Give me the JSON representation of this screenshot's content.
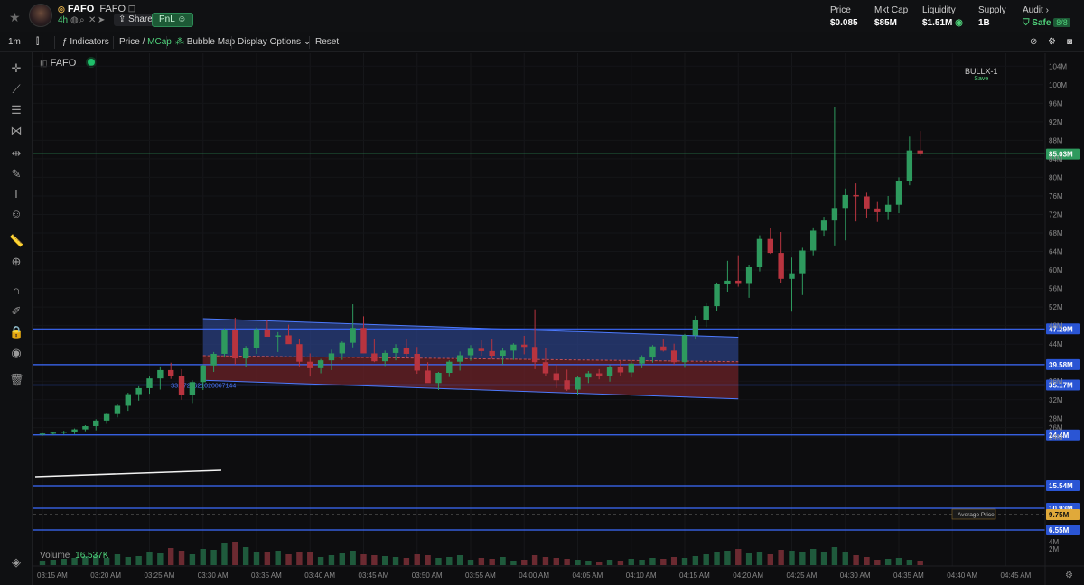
{
  "header": {
    "token_symbol": "FAFO",
    "token_name": "FAFO",
    "age": "4h",
    "share_label": "Share",
    "pnl_label": "PnL",
    "stats": [
      {
        "label": "Price",
        "value": "$0.085"
      },
      {
        "label": "Mkt Cap",
        "value": "$85M"
      },
      {
        "label": "Liquidity",
        "value": "$1.51M"
      },
      {
        "label": "Supply",
        "value": "1B"
      },
      {
        "label": "Audit",
        "value": "Safe",
        "extra": "8/8"
      }
    ]
  },
  "toolbar": {
    "interval": "1m",
    "indicators": "Indicators",
    "price": "Price",
    "slash": "/",
    "mcap": "MCap",
    "bubble_map": "Bubble Map",
    "display_options": "Display Options",
    "reset": "Reset",
    "layout_name": "BULLX-1",
    "layout_save": "Save"
  },
  "left_tools": [
    "crosshair-icon",
    "trendline-icon",
    "fib-icon",
    "pattern-icon",
    "forecast-icon",
    "brush-icon",
    "text-icon",
    "emoji-icon",
    "ruler-icon",
    "zoom-icon",
    "magnet-icon",
    "lock-draw-icon",
    "lock-icon",
    "eye-icon",
    "trash-icon",
    "layers-icon"
  ],
  "legend": {
    "symbol": "FAFO",
    "volume_label": "Volume",
    "volume_value": "16.537K"
  },
  "chart_data": {
    "type": "candlestick",
    "y_unit": "market cap (USD)",
    "ylim": [
      0,
      106
    ],
    "y_ticks": [
      "2M",
      "4M",
      "24M",
      "26M",
      "28M",
      "32M",
      "36M",
      "44M",
      "48M",
      "52M",
      "56M",
      "60M",
      "64M",
      "68M",
      "72M",
      "76M",
      "80M",
      "84M",
      "88M",
      "92M",
      "96M",
      "100M",
      "104M"
    ],
    "x_ticks": [
      "03:15 AM",
      "03:20 AM",
      "03:25 AM",
      "03:30 AM",
      "03:35 AM",
      "03:40 AM",
      "03:45 AM",
      "03:50 AM",
      "03:55 AM",
      "04:00 AM",
      "04:05 AM",
      "04:10 AM",
      "04:15 AM",
      "04:20 AM",
      "04:25 AM",
      "04:30 AM",
      "04:35 AM",
      "04:40 AM",
      "04:45 AM"
    ],
    "candles": [
      [
        24.5,
        24.8,
        24.2,
        24.7
      ],
      [
        24.7,
        25.0,
        24.4,
        24.9
      ],
      [
        24.9,
        25.3,
        24.5,
        25.1
      ],
      [
        25.1,
        25.8,
        24.6,
        25.6
      ],
      [
        25.6,
        26.5,
        25.2,
        26.3
      ],
      [
        26.3,
        27.8,
        25.4,
        27.5
      ],
      [
        27.5,
        29.2,
        26.8,
        28.9
      ],
      [
        28.9,
        31.0,
        28.2,
        30.7
      ],
      [
        30.7,
        33.5,
        29.6,
        33.2
      ],
      [
        33.2,
        34.9,
        31.8,
        34.5
      ],
      [
        34.5,
        37.0,
        33.3,
        36.6
      ],
      [
        36.6,
        39.2,
        34.2,
        38.4
      ],
      [
        38.4,
        40.0,
        36.5,
        37.2
      ],
      [
        37.2,
        38.6,
        32.0,
        33.1
      ],
      [
        33.1,
        36.2,
        31.3,
        35.8
      ],
      [
        35.8,
        39.6,
        34.1,
        39.4
      ],
      [
        39.4,
        42.3,
        38.0,
        41.9
      ],
      [
        41.9,
        47.4,
        41.1,
        47.0
      ],
      [
        47.0,
        49.7,
        39.6,
        40.9
      ],
      [
        40.9,
        43.6,
        39.1,
        43.1
      ],
      [
        43.1,
        47.6,
        41.9,
        47.2
      ],
      [
        47.2,
        49.3,
        45.8,
        45.6
      ],
      [
        45.6,
        46.6,
        42.3,
        45.9
      ],
      [
        45.9,
        48.2,
        44.1,
        44.0
      ],
      [
        44.0,
        45.2,
        39.2,
        40.2
      ],
      [
        40.2,
        42.0,
        37.0,
        38.8
      ],
      [
        38.8,
        40.8,
        37.7,
        40.5
      ],
      [
        40.5,
        42.8,
        38.4,
        42.0
      ],
      [
        42.0,
        44.6,
        40.6,
        44.3
      ],
      [
        44.3,
        52.6,
        43.3,
        47.5
      ],
      [
        47.5,
        50.0,
        42.6,
        42.0
      ],
      [
        42.0,
        45.0,
        40.1,
        40.3
      ],
      [
        40.3,
        42.6,
        39.3,
        42.1
      ],
      [
        42.1,
        44.0,
        40.5,
        43.2
      ],
      [
        43.2,
        45.1,
        41.3,
        41.9
      ],
      [
        41.9,
        43.4,
        37.6,
        38.3
      ],
      [
        38.3,
        40.1,
        35.7,
        35.6
      ],
      [
        35.6,
        38.0,
        34.1,
        37.8
      ],
      [
        37.8,
        40.5,
        36.9,
        40.2
      ],
      [
        40.2,
        42.4,
        38.3,
        41.6
      ],
      [
        41.6,
        43.8,
        40.4,
        43.0
      ],
      [
        43.0,
        44.8,
        41.5,
        42.5
      ],
      [
        42.5,
        45.0,
        40.9,
        41.5
      ],
      [
        41.5,
        43.1,
        39.6,
        42.6
      ],
      [
        42.6,
        44.2,
        40.6,
        43.9
      ],
      [
        43.9,
        45.8,
        41.8,
        43.4
      ],
      [
        43.4,
        51.5,
        38.6,
        40.1
      ],
      [
        40.1,
        43.1,
        37.2,
        37.7
      ],
      [
        37.7,
        39.7,
        34.5,
        36.2
      ],
      [
        36.2,
        38.5,
        33.9,
        34.2
      ],
      [
        34.2,
        37.2,
        33.1,
        36.8
      ],
      [
        36.8,
        38.2,
        35.6,
        37.7
      ],
      [
        37.7,
        38.6,
        36.4,
        37.1
      ],
      [
        37.1,
        39.5,
        35.9,
        39.1
      ],
      [
        39.1,
        40.5,
        37.2,
        37.9
      ],
      [
        37.9,
        40.4,
        36.8,
        39.8
      ],
      [
        39.8,
        41.6,
        38.8,
        41.1
      ],
      [
        41.1,
        43.8,
        40.0,
        43.5
      ],
      [
        43.5,
        45.2,
        42.4,
        42.6
      ],
      [
        42.6,
        44.1,
        39.6,
        40.1
      ],
      [
        40.1,
        46.2,
        38.9,
        45.9
      ],
      [
        45.9,
        50.1,
        45.0,
        49.3
      ],
      [
        49.3,
        52.8,
        47.7,
        52.2
      ],
      [
        52.2,
        57.3,
        51.1,
        56.9
      ],
      [
        56.9,
        62.0,
        55.2,
        57.7
      ],
      [
        57.7,
        63.0,
        56.4,
        57.0
      ],
      [
        57.0,
        61.0,
        54.0,
        60.6
      ],
      [
        60.6,
        67.5,
        59.7,
        66.7
      ],
      [
        66.7,
        69.0,
        63.5,
        63.7
      ],
      [
        63.7,
        68.2,
        57.1,
        58.1
      ],
      [
        58.1,
        62.7,
        51.0,
        59.3
      ],
      [
        59.3,
        64.8,
        54.6,
        64.2
      ],
      [
        64.2,
        69.2,
        63.0,
        68.5
      ],
      [
        68.5,
        71.5,
        67.4,
        70.7
      ],
      [
        70.7,
        95.2,
        65.3,
        73.4
      ],
      [
        73.4,
        77.6,
        66.4,
        76.2
      ],
      [
        76.2,
        78.7,
        70.5,
        75.9
      ],
      [
        75.9,
        76.7,
        71.3,
        73.3
      ],
      [
        73.3,
        74.7,
        70.4,
        72.5
      ],
      [
        72.5,
        76.0,
        70.8,
        74.1
      ],
      [
        74.1,
        80.0,
        72.3,
        79.2
      ],
      [
        79.2,
        88.8,
        78.3,
        85.8
      ],
      [
        85.8,
        90.0,
        84.6,
        85.0
      ]
    ],
    "volumes": [
      0.5,
      0.6,
      0.7,
      0.8,
      1.0,
      1.1,
      0.8,
      1.2,
      0.9,
      1.0,
      1.5,
      1.3,
      1.9,
      1.6,
      1.2,
      1.8,
      1.7,
      2.5,
      2.6,
      2.0,
      1.5,
      1.4,
      1.6,
      1.2,
      1.4,
      1.5,
      0.9,
      1.1,
      1.3,
      1.6,
      1.2,
      1.1,
      1.0,
      0.9,
      0.8,
      1.2,
      1.1,
      0.8,
      0.9,
      1.1,
      0.6,
      0.8,
      0.7,
      0.9,
      0.5,
      0.6,
      1.1,
      0.9,
      0.8,
      0.7,
      0.6,
      0.5,
      0.4,
      0.6,
      0.5,
      0.7,
      0.6,
      0.8,
      0.7,
      0.9,
      0.8,
      1.0,
      1.2,
      1.4,
      1.6,
      1.8,
      1.3,
      1.5,
      1.2,
      1.7,
      1.6,
      1.4,
      1.8,
      1.5,
      2.0,
      1.4,
      1.1,
      0.9,
      0.6,
      0.7,
      0.8,
      0.6,
      0.5
    ],
    "horizontal_levels": [
      {
        "label": "47.29M",
        "value": 47.29,
        "color": "#3d6bff"
      },
      {
        "label": "39.58M",
        "value": 39.58,
        "color": "#3d6bff"
      },
      {
        "label": "35.17M",
        "value": 35.17,
        "color": "#3d6bff"
      },
      {
        "label": "24.4M",
        "value": 24.4,
        "color": "#3d6bff"
      },
      {
        "label": "15.54M",
        "value": 15.54,
        "color": "#3d6bff"
      },
      {
        "label": "10.93M",
        "value": 10.93,
        "color": "#3d6bff"
      },
      {
        "label": "6.55M",
        "value": 6.55,
        "color": "#3d6bff"
      }
    ],
    "current_price": {
      "label": "85.03M",
      "value": 85.03
    },
    "average_price": {
      "label": "9.75M",
      "value": 9.75,
      "tag": "Average Price"
    },
    "drawing_text": "$3.1725621020067144",
    "colors": {
      "up": "#2e9a5e",
      "down": "#b8343f",
      "zone_top": "#2a3f80",
      "zone_bottom": "#6b2228"
    }
  }
}
